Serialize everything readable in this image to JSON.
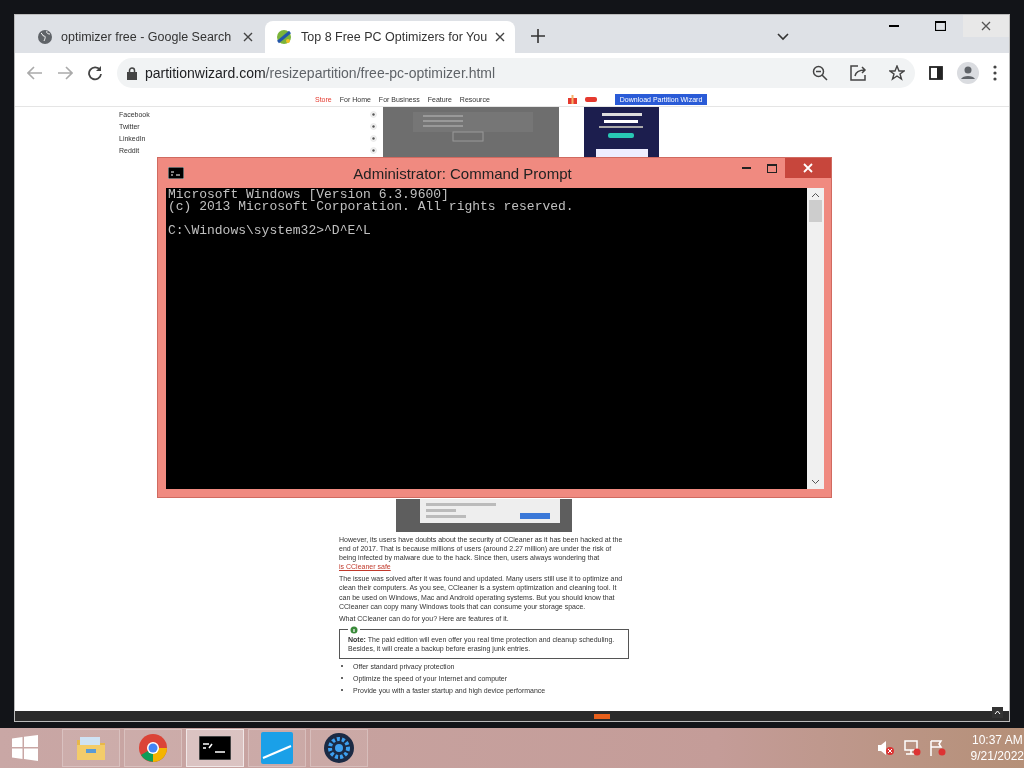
{
  "browser": {
    "tabs": [
      {
        "title": "optimizer free - Google Search",
        "selected": false
      },
      {
        "title": "Top 8 Free PC Optimizers for You",
        "selected": true
      }
    ],
    "address": {
      "domain": "partitionwizard.com",
      "path": "/resizepartition/free-pc-optimizer.html"
    }
  },
  "page": {
    "nav": [
      {
        "label": "Store",
        "selected": true
      },
      {
        "label": "For Home",
        "selected": false
      },
      {
        "label": "For Business",
        "selected": false
      },
      {
        "label": "Feature",
        "selected": false
      },
      {
        "label": "Resource",
        "selected": false
      }
    ],
    "download_button": "Download Partition Wizard",
    "share_links": [
      "Facebook",
      "Twitter",
      "LinkedIn",
      "Reddit"
    ],
    "paragraphs": [
      {
        "text": "However, its users have doubts about the security of CCleaner as it has been hacked at the end of 2017. That is because millions of users (around 2.27 million) are under the risk of being infected by malware due to the hack. Since then, users always wondering that",
        "link": "is CCleaner safe"
      },
      {
        "text": "The issue was solved after it was found and updated. Many users still use it to optimize and clean their computers. As you see, CCleaner is a system optimization and cleaning tool. It can be used on Windows, Mac and Android operating systems. But you should know that CCleaner can copy many Windows tools that can consume your storage space."
      },
      {
        "text": "What CCleaner can do for you? Here are features of it."
      }
    ],
    "note": {
      "label": "Note:",
      "text": "The paid edition will even offer you real time protection and cleanup scheduling. Besides, it will create a backup before erasing junk entries."
    },
    "bullets": [
      "Offer standard privacy protection",
      "Optimize the speed of your Internet and computer",
      "Provide you with a faster startup and high device performance"
    ]
  },
  "cmd": {
    "title": "Administrator: Command Prompt",
    "header_lines": [
      "Microsoft Windows [Version 6.3.9600]",
      "(c) 2013 Microsoft Corporation. All rights reserved."
    ],
    "prompt": "C:\\Windows\\system32>^D^E^L"
  },
  "taskbar": {
    "apps": [
      {
        "kind": "explorer",
        "selected": false
      },
      {
        "kind": "chrome",
        "selected": false
      },
      {
        "kind": "terminal",
        "selected": true
      },
      {
        "kind": "blue",
        "selected": false
      },
      {
        "kind": "gear",
        "selected": false
      }
    ],
    "time": "10:37 AM",
    "date": "9/21/2022"
  }
}
